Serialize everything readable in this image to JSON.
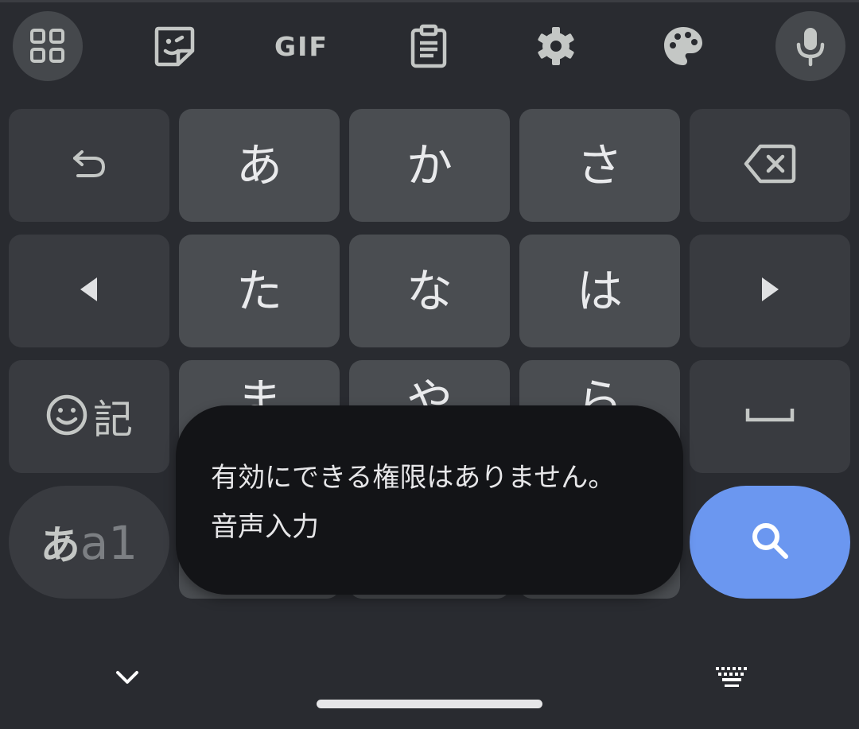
{
  "toolbar": {
    "items": [
      {
        "icon": "apps-grid-icon"
      },
      {
        "icon": "sticker-icon"
      },
      {
        "icon": "gif-icon",
        "label": "GIF"
      },
      {
        "icon": "clipboard-icon"
      },
      {
        "icon": "settings-gear-icon"
      },
      {
        "icon": "theme-palette-icon"
      },
      {
        "icon": "microphone-icon"
      }
    ]
  },
  "keys": {
    "row1": {
      "undo_icon": "undo-icon",
      "k1": "あ",
      "k2": "か",
      "k3": "さ",
      "backspace_icon": "backspace-icon"
    },
    "row2": {
      "left_icon": "cursor-left-icon",
      "k1": "た",
      "k2": "な",
      "k3": "は",
      "right_icon": "cursor-right-icon"
    },
    "row3": {
      "emoji_kanji": "記",
      "k1": "ま",
      "k2": "や",
      "k3": "ら",
      "space_icon": "space-icon"
    },
    "row4": {
      "mode_kana": "あ",
      "mode_alnum": "a1",
      "search_icon": "search-icon"
    }
  },
  "toast": {
    "line1": "有効にできる権限はありません。",
    "line2": "音声入力"
  },
  "navbar": {
    "hide_keyboard_icon": "chevron-down-icon",
    "switch_keyboard_icon": "keyboard-icon"
  },
  "colors": {
    "background": "#292b30",
    "function_key": "#393b40",
    "character_key": "#4a4d51",
    "search_key": "#6b97f0",
    "toast_background": "#131417",
    "icon": "#c4c7c5"
  }
}
